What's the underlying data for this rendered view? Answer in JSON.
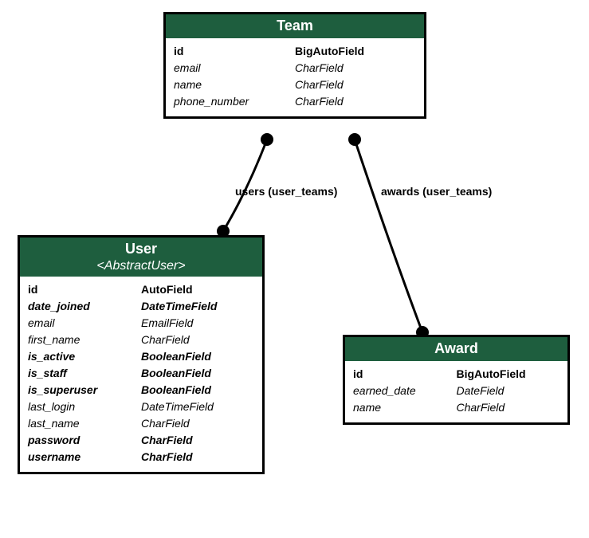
{
  "entities": {
    "team": {
      "title": "Team",
      "fields": [
        {
          "name": "id",
          "type": "BigAutoField",
          "style": "bold"
        },
        {
          "name": "email",
          "type": "CharField",
          "style": "italic"
        },
        {
          "name": "name",
          "type": "CharField",
          "style": "italic"
        },
        {
          "name": "phone_number",
          "type": "CharField",
          "style": "italic"
        }
      ]
    },
    "user": {
      "title": "User",
      "subtitle": "<AbstractUser>",
      "fields": [
        {
          "name": "id",
          "type": "AutoField",
          "style": "bold"
        },
        {
          "name": "date_joined",
          "type": "DateTimeField",
          "style": "bolditalic"
        },
        {
          "name": "email",
          "type": "EmailField",
          "style": "italic"
        },
        {
          "name": "first_name",
          "type": "CharField",
          "style": "italic"
        },
        {
          "name": "is_active",
          "type": "BooleanField",
          "style": "bolditalic"
        },
        {
          "name": "is_staff",
          "type": "BooleanField",
          "style": "bolditalic"
        },
        {
          "name": "is_superuser",
          "type": "BooleanField",
          "style": "bolditalic"
        },
        {
          "name": "last_login",
          "type": "DateTimeField",
          "style": "italic"
        },
        {
          "name": "last_name",
          "type": "CharField",
          "style": "italic"
        },
        {
          "name": "password",
          "type": "CharField",
          "style": "bolditalic"
        },
        {
          "name": "username",
          "type": "CharField",
          "style": "bolditalic"
        }
      ]
    },
    "award": {
      "title": "Award",
      "fields": [
        {
          "name": "id",
          "type": "BigAutoField",
          "style": "bold"
        },
        {
          "name": "earned_date",
          "type": "DateField",
          "style": "italic"
        },
        {
          "name": "name",
          "type": "CharField",
          "style": "italic"
        }
      ]
    }
  },
  "relationships": {
    "users": "users (user_teams)",
    "awards": "awards (user_teams)"
  }
}
